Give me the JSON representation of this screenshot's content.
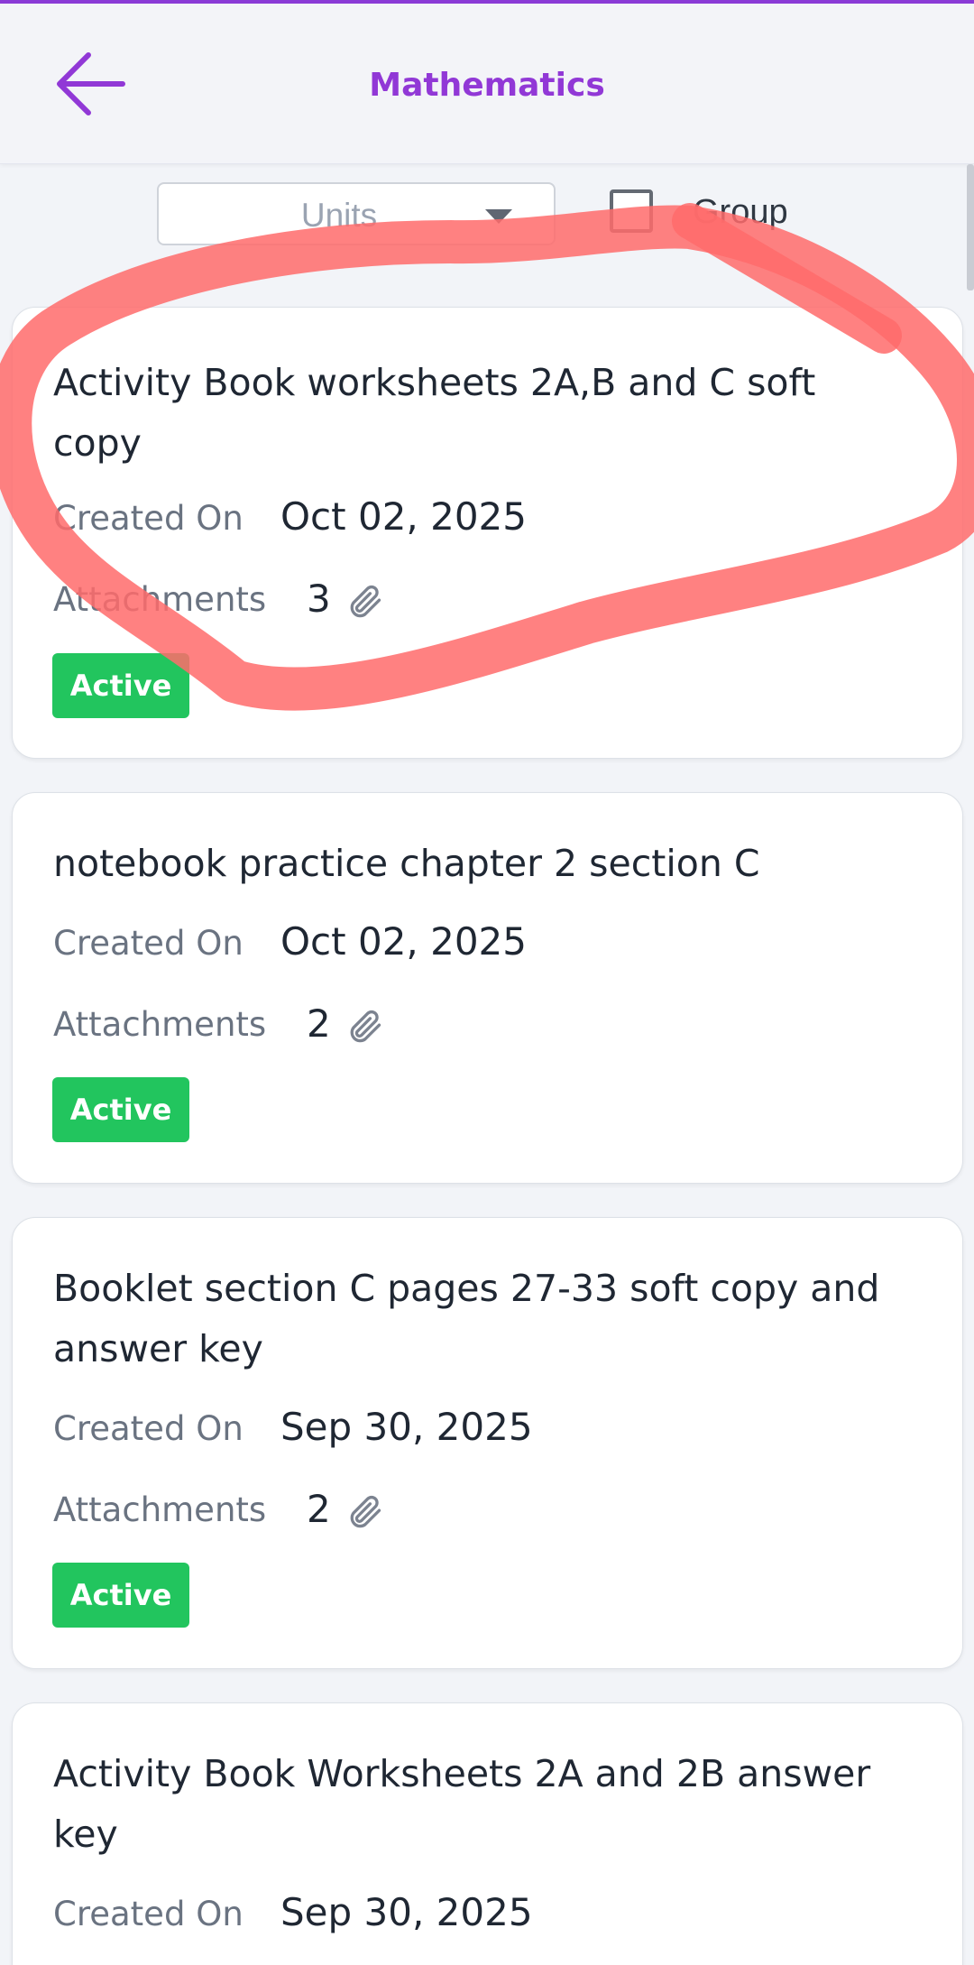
{
  "header": {
    "title": "Mathematics",
    "back_icon": "arrow-left-icon",
    "accent_color": "#9138d6"
  },
  "filters": {
    "units_placeholder": "Units",
    "group_label": "Group",
    "group_checked": false
  },
  "labels": {
    "created_on": "Created On",
    "attachments": "Attachments",
    "attachment_icon": "paperclip-icon"
  },
  "status_color": "#22c55e",
  "annotation_color": "#ff6b6b",
  "assignments": [
    {
      "title": "Activity Book worksheets 2A,B and C soft copy",
      "created_on": "Oct 02, 2025",
      "attachments": "3",
      "status": "Active"
    },
    {
      "title": "notebook practice chapter 2 section C",
      "created_on": "Oct 02, 2025",
      "attachments": "2",
      "status": "Active"
    },
    {
      "title": "Booklet section C pages 27-33 soft copy and answer key",
      "created_on": "Sep 30, 2025",
      "attachments": "2",
      "status": "Active"
    },
    {
      "title": "Activity Book Worksheets 2A and 2B answer key",
      "created_on": "Sep 30, 2025"
    }
  ]
}
